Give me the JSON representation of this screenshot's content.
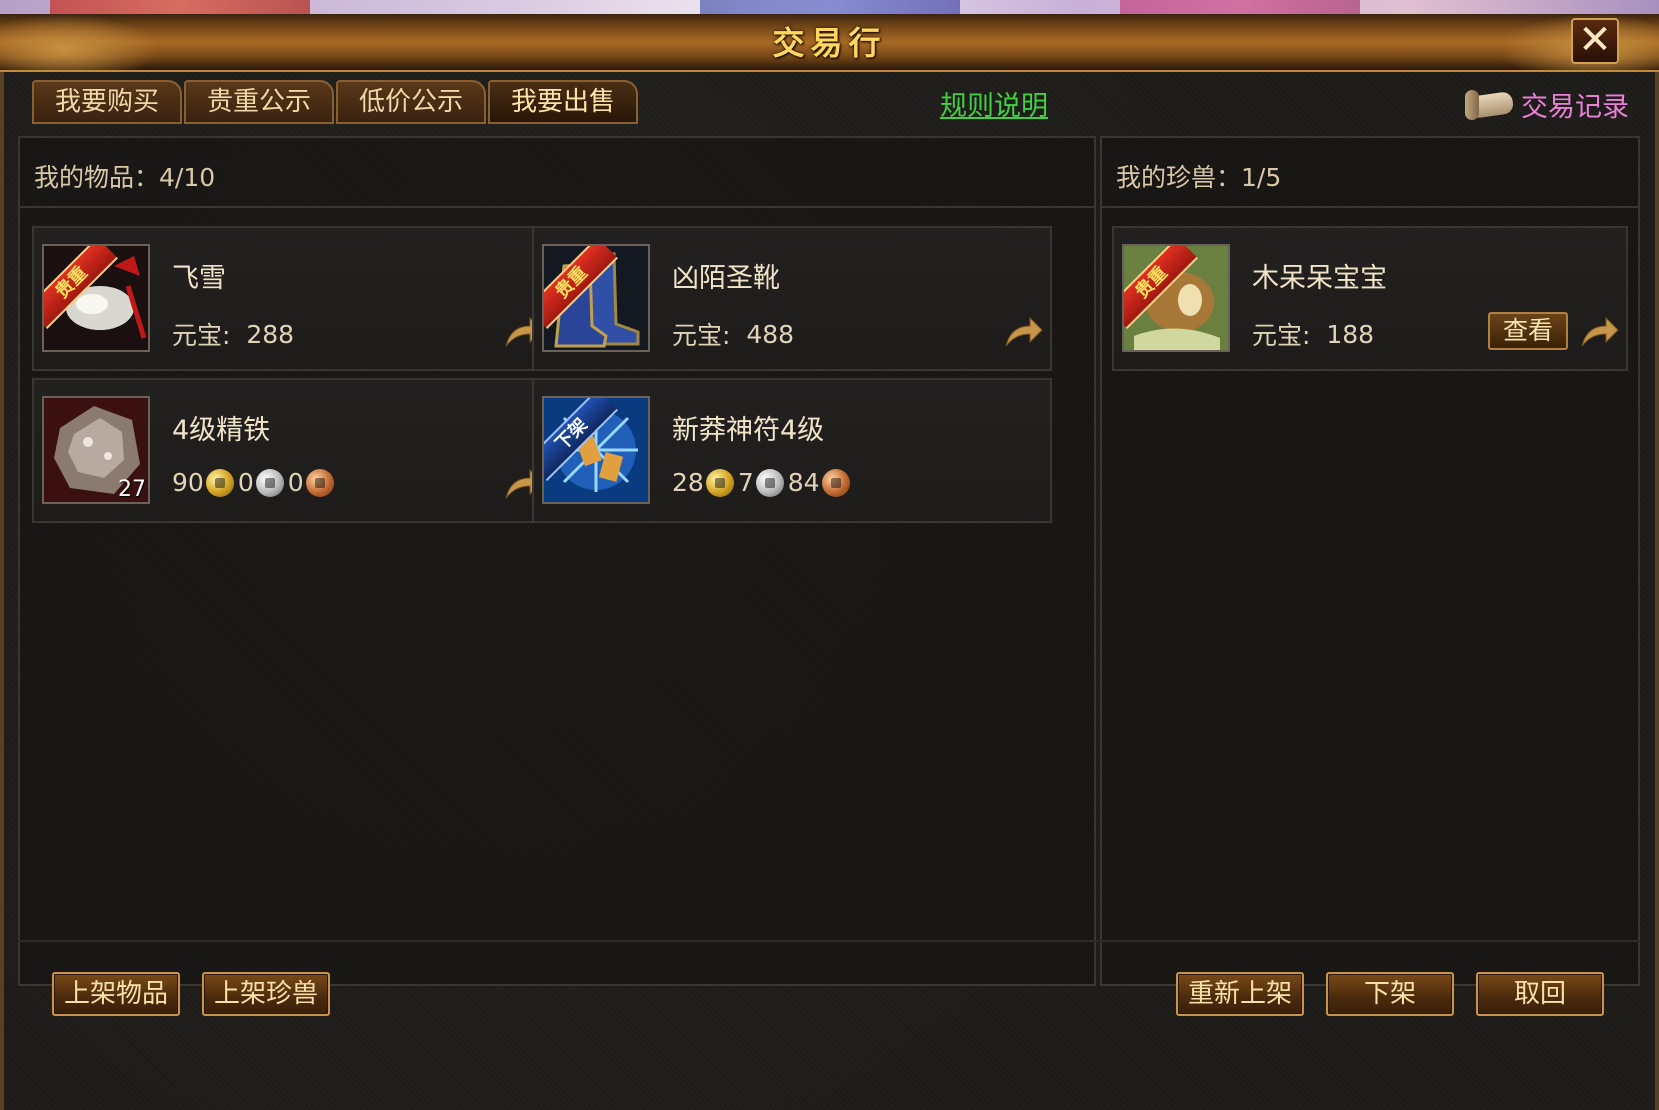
{
  "window": {
    "title": "交易行",
    "close_symbol": "✕"
  },
  "tabs": [
    {
      "label": "我要购买"
    },
    {
      "label": "贵重公示"
    },
    {
      "label": "低价公示"
    },
    {
      "label": "我要出售"
    }
  ],
  "links": {
    "rules": "规则说明",
    "history": "交易记录"
  },
  "items_panel": {
    "header_label": "我的物品：",
    "count": "4/10",
    "items": [
      {
        "name": "飞雪",
        "ribbon": "贵重",
        "price_label": "元宝:",
        "price": "288",
        "icon": "jade-pendant-icon"
      },
      {
        "name": "凶陌圣靴",
        "ribbon": "贵重",
        "price_label": "元宝:",
        "price": "488",
        "icon": "boots-icon"
      },
      {
        "name": "4级精铁",
        "quantity": "27",
        "gold": "90",
        "silver": "0",
        "copper": "0",
        "icon": "iron-ore-icon"
      },
      {
        "name": "新莽神符4级",
        "ribbon": "下架",
        "gold": "28",
        "silver": "7",
        "copper": "84",
        "icon": "talisman-icon"
      }
    ]
  },
  "pets_panel": {
    "header_label": "我的珍兽：",
    "count": "1/5",
    "pets": [
      {
        "name": "木呆呆宝宝",
        "ribbon": "贵重",
        "price_label": "元宝:",
        "price": "188",
        "view_label": "查看",
        "icon": "wooden-beast-icon"
      }
    ]
  },
  "bottom_buttons": {
    "list_item": "上架物品",
    "list_pet": "上架珍兽",
    "relist": "重新上架",
    "unlist": "下架",
    "retrieve": "取回"
  },
  "colors": {
    "title": "#ffd860",
    "rules_link": "#40d040",
    "history_link": "#e880d8",
    "gold_coin": "#d0a020",
    "silver_coin": "#b8b8b8",
    "copper_coin": "#c06830"
  }
}
